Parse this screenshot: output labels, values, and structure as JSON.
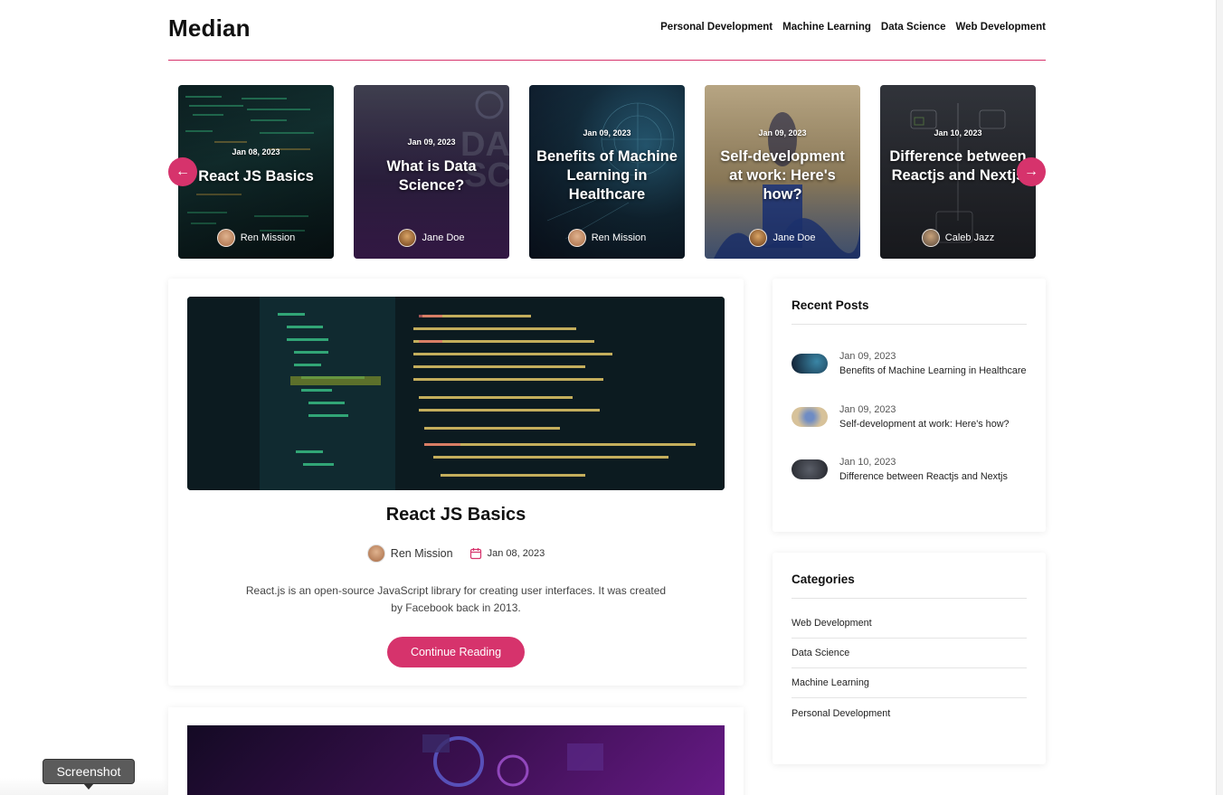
{
  "header": {
    "brand": "Median",
    "nav": [
      "Personal Development",
      "Machine Learning",
      "Data Science",
      "Web Development"
    ]
  },
  "carousel": {
    "cards": [
      {
        "date": "Jan 08, 2023",
        "title": "React JS Basics",
        "author": "Ren Mission"
      },
      {
        "date": "Jan 09, 2023",
        "title": "What is Data Science?",
        "author": "Jane Doe"
      },
      {
        "date": "Jan 09, 2023",
        "title": "Benefits of Machine Learning in Healthcare",
        "author": "Ren Mission"
      },
      {
        "date": "Jan 09, 2023",
        "title": "Self-development at work: Here's how?",
        "author": "Jane Doe"
      },
      {
        "date": "Jan 10, 2023",
        "title": "Difference between Reactjs and Nextjs",
        "author": "Caleb Jazz"
      }
    ],
    "prev_icon": "arrow-left-icon",
    "next_icon": "arrow-right-icon"
  },
  "post": {
    "title": "React JS Basics",
    "author": "Ren Mission",
    "date": "Jan 08, 2023",
    "excerpt": "React.js is an open-source JavaScript library for creating user interfaces. It was created by Facebook back in 2013.",
    "button": "Continue Reading"
  },
  "recent": {
    "heading": "Recent Posts",
    "items": [
      {
        "date": "Jan 09, 2023",
        "title": "Benefits of Machine Learning in Healthcare"
      },
      {
        "date": "Jan 09, 2023",
        "title": "Self-development at work: Here's how?"
      },
      {
        "date": "Jan 10, 2023",
        "title": "Difference between Reactjs and Nextjs"
      }
    ]
  },
  "categories": {
    "heading": "Categories",
    "items": [
      "Web Development",
      "Data Science",
      "Machine Learning",
      "Personal Development"
    ]
  },
  "tooltip": "Screenshot",
  "colors": {
    "accent": "#d6336c"
  }
}
